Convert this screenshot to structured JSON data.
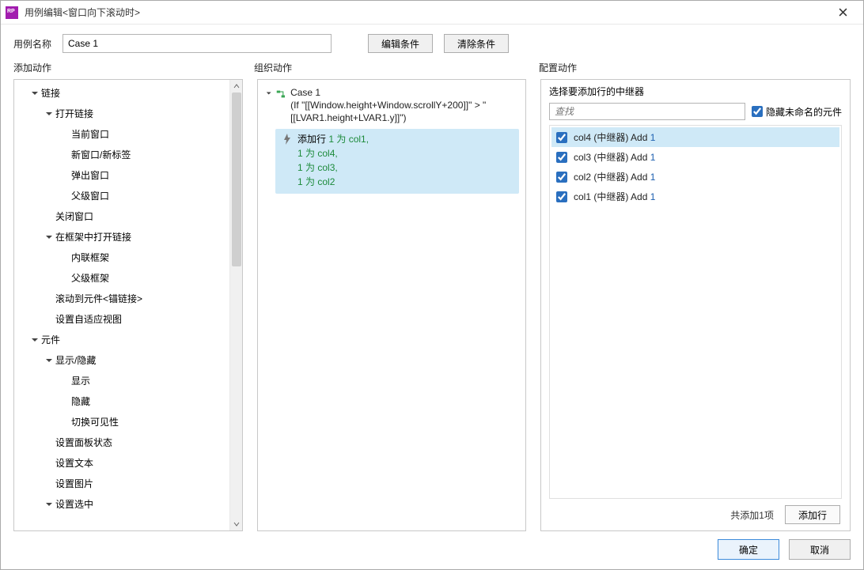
{
  "window": {
    "title": "用例编辑<窗口向下滚动时>"
  },
  "top": {
    "name_label": "用例名称",
    "case_value": "Case 1",
    "edit_cond_btn": "编辑条件",
    "clear_cond_btn": "清除条件"
  },
  "sections": {
    "add_action": "添加动作",
    "organize_action": "组织动作",
    "config_action": "配置动作"
  },
  "tree": [
    {
      "label": "链接",
      "level": 1,
      "expandable": true
    },
    {
      "label": "打开链接",
      "level": 2,
      "expandable": true
    },
    {
      "label": "当前窗口",
      "level": 3,
      "expandable": false
    },
    {
      "label": "新窗口/新标签",
      "level": 3,
      "expandable": false
    },
    {
      "label": "弹出窗口",
      "level": 3,
      "expandable": false
    },
    {
      "label": "父级窗口",
      "level": 3,
      "expandable": false
    },
    {
      "label": "关闭窗口",
      "level": 2,
      "expandable": false
    },
    {
      "label": "在框架中打开链接",
      "level": 2,
      "expandable": true
    },
    {
      "label": "内联框架",
      "level": 3,
      "expandable": false
    },
    {
      "label": "父级框架",
      "level": 3,
      "expandable": false
    },
    {
      "label": "滚动到元件<锚链接>",
      "level": 2,
      "expandable": false
    },
    {
      "label": "设置自适应视图",
      "level": 2,
      "expandable": false
    },
    {
      "label": "元件",
      "level": 1,
      "expandable": true
    },
    {
      "label": "显示/隐藏",
      "level": 2,
      "expandable": true
    },
    {
      "label": "显示",
      "level": 3,
      "expandable": false
    },
    {
      "label": "隐藏",
      "level": 3,
      "expandable": false
    },
    {
      "label": "切换可见性",
      "level": 3,
      "expandable": false
    },
    {
      "label": "设置面板状态",
      "level": 2,
      "expandable": false
    },
    {
      "label": "设置文本",
      "level": 2,
      "expandable": false
    },
    {
      "label": "设置图片",
      "level": 2,
      "expandable": false
    },
    {
      "label": "设置选中",
      "level": 2,
      "expandable": true
    }
  ],
  "case": {
    "name": "Case 1",
    "condition": "(If \"[[Window.height+Window.scrollY+200]]\" > \"[[LVAR1.height+LVAR1.y]]\")",
    "action_title": "添加行",
    "action_parts": [
      {
        "pre": " ",
        "num": "1",
        "mid": " 为 ",
        "col": "col1",
        "tail": ","
      },
      {
        "pre": "",
        "num": "1",
        "mid": " 为 ",
        "col": "col4",
        "tail": ","
      },
      {
        "pre": "",
        "num": "1",
        "mid": " 为 ",
        "col": "col3",
        "tail": ","
      },
      {
        "pre": "",
        "num": "1",
        "mid": " 为 ",
        "col": "col2",
        "tail": ""
      }
    ]
  },
  "right": {
    "title": "选择要添加行的中继器",
    "search_placeholder": "查找",
    "hide_unnamed_label": "隐藏未命名的元件",
    "items": [
      {
        "name": "col4",
        "suffix": " (中继器) Add ",
        "num": "1",
        "selected": true
      },
      {
        "name": "col3",
        "suffix": " (中继器) Add ",
        "num": "1",
        "selected": false
      },
      {
        "name": "col2",
        "suffix": " (中继器) Add ",
        "num": "1",
        "selected": false
      },
      {
        "name": "col1",
        "suffix": " (中继器) Add ",
        "num": "1",
        "selected": false
      }
    ],
    "footer_count": "共添加1项",
    "add_row_btn": "添加行"
  },
  "bottom": {
    "ok": "确定",
    "cancel": "取消"
  }
}
